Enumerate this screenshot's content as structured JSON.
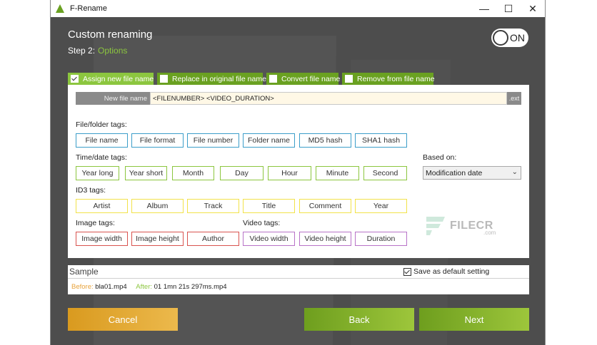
{
  "window": {
    "title": "F-Rename",
    "minimize": "—",
    "maximize": "☐",
    "close": "✕"
  },
  "header": {
    "title": "Custom renaming",
    "step_label": "Step 2:",
    "step_name": "Options"
  },
  "toggle": {
    "label": "ON",
    "state": "on"
  },
  "tabs": [
    {
      "label": "Assign new file name",
      "checked": true,
      "active": true
    },
    {
      "label": "Replace in original file name",
      "checked": false
    },
    {
      "label": "Convert file name",
      "checked": false
    },
    {
      "label": "Remove from file name",
      "checked": false
    }
  ],
  "new_file_name": {
    "label": "New file name",
    "value": "<FILENUMBER> <VIDEO_DURATION>",
    "ext": ".ext"
  },
  "groups": {
    "file_folder": {
      "label": "File/folder tags:",
      "tags": [
        "File name",
        "File format",
        "File number",
        "Folder name",
        "MD5 hash",
        "SHA1 hash"
      ]
    },
    "time_date": {
      "label": "Time/date tags:",
      "tags": [
        "Year long",
        "Year short",
        "Month",
        "Day",
        "Hour",
        "Minute",
        "Second"
      ]
    },
    "id3": {
      "label": "ID3 tags:",
      "tags": [
        "Artist",
        "Album",
        "Track",
        "Title",
        "Comment",
        "Year"
      ]
    },
    "image": {
      "label": "Image tags:",
      "tags": [
        "Image width",
        "Image height",
        "Author"
      ]
    },
    "video": {
      "label": "Video tags:",
      "tags": [
        "Video width",
        "Video height",
        "Duration"
      ]
    }
  },
  "based_on": {
    "label": "Based on:",
    "value": "Modification date"
  },
  "watermark": {
    "text": "FILECR",
    "sub": ".com"
  },
  "sample": {
    "title": "Sample",
    "default_label": "Save as default setting",
    "before_label": "Before:",
    "before_value": "bla01.mp4",
    "after_label": "After:",
    "after_value": "01 1mn 21s 297ms.mp4"
  },
  "buttons": {
    "cancel": "Cancel",
    "back": "Back",
    "next": "Next"
  },
  "colors": {
    "accent_green": "#8cc63f",
    "tab_green": "#6aa121",
    "cancel_orange": "#e6a93a",
    "window_bg": "#4d4d4d"
  }
}
